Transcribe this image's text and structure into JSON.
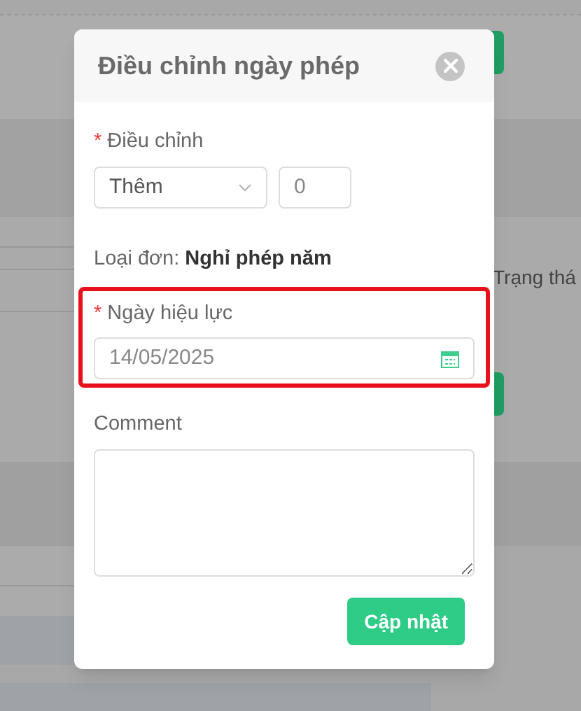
{
  "background": {
    "column_label": "Trạng thá"
  },
  "dialog": {
    "title": "Điều chỉnh ngày phép",
    "adjustment": {
      "label": "Điều chỉnh",
      "required_mark": "*",
      "type_value": "Thêm",
      "amount": "0"
    },
    "leave_type": {
      "label": "Loại đơn:",
      "value": "Nghỉ phép năm"
    },
    "effective_date": {
      "label": "Ngày hiệu lực",
      "required_mark": "*",
      "value": "14/05/2025",
      "highlighted": true
    },
    "comment": {
      "label": "Comment"
    },
    "submit": "Cập nhật"
  }
}
